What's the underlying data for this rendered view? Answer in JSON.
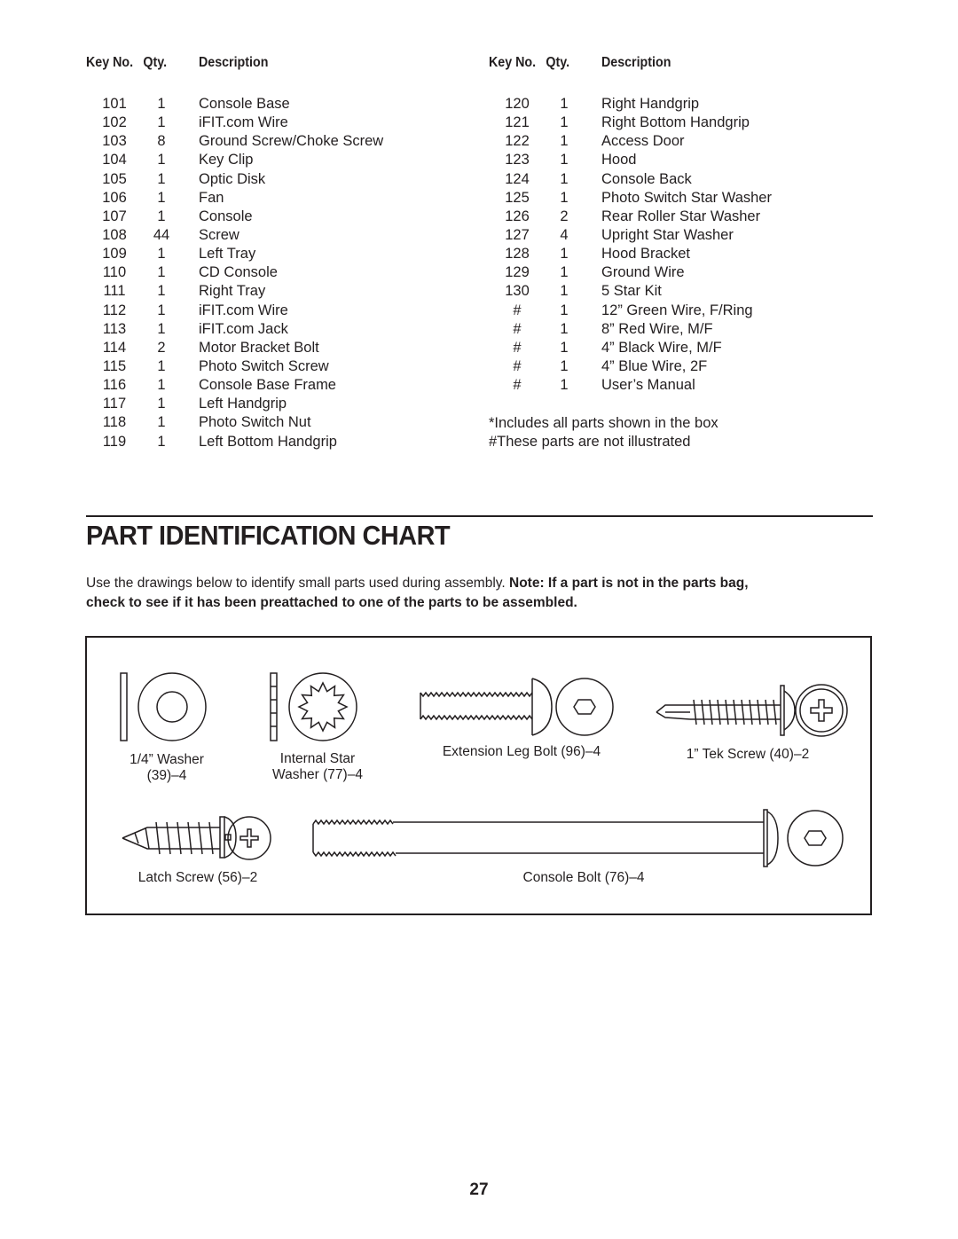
{
  "parts_list": {
    "headers": {
      "key": "Key No.",
      "qty": "Qty.",
      "desc": "Description"
    },
    "left_rows": [
      {
        "key": "101",
        "qty": "1",
        "desc": "Console Base"
      },
      {
        "key": "102",
        "qty": "1",
        "desc": "iFIT.com Wire"
      },
      {
        "key": "103",
        "qty": "8",
        "desc": "Ground Screw/Choke Screw"
      },
      {
        "key": "104",
        "qty": "1",
        "desc": "Key Clip"
      },
      {
        "key": "105",
        "qty": "1",
        "desc": "Optic Disk"
      },
      {
        "key": "106",
        "qty": "1",
        "desc": "Fan"
      },
      {
        "key": "107",
        "qty": "1",
        "desc": "Console"
      },
      {
        "key": "108",
        "qty": "44",
        "desc": "Screw"
      },
      {
        "key": "109",
        "qty": "1",
        "desc": "Left Tray"
      },
      {
        "key": "110",
        "qty": "1",
        "desc": "CD Console"
      },
      {
        "key": "111",
        "qty": "1",
        "desc": "Right Tray"
      },
      {
        "key": "112",
        "qty": "1",
        "desc": "iFIT.com Wire"
      },
      {
        "key": "113",
        "qty": "1",
        "desc": "iFIT.com Jack"
      },
      {
        "key": "114",
        "qty": "2",
        "desc": "Motor Bracket Bolt"
      },
      {
        "key": "115",
        "qty": "1",
        "desc": "Photo Switch Screw"
      },
      {
        "key": "116",
        "qty": "1",
        "desc": "Console Base Frame"
      },
      {
        "key": "117",
        "qty": "1",
        "desc": "Left Handgrip"
      },
      {
        "key": "118",
        "qty": "1",
        "desc": "Photo Switch Nut"
      },
      {
        "key": "119",
        "qty": "1",
        "desc": "Left Bottom Handgrip"
      }
    ],
    "right_rows": [
      {
        "key": "120",
        "qty": "1",
        "desc": "Right Handgrip"
      },
      {
        "key": "121",
        "qty": "1",
        "desc": "Right Bottom Handgrip"
      },
      {
        "key": "122",
        "qty": "1",
        "desc": "Access Door"
      },
      {
        "key": "123",
        "qty": "1",
        "desc": "Hood"
      },
      {
        "key": "124",
        "qty": "1",
        "desc": "Console Back"
      },
      {
        "key": "125",
        "qty": "1",
        "desc": "Photo Switch Star Washer"
      },
      {
        "key": "126",
        "qty": "2",
        "desc": "Rear Roller Star Washer"
      },
      {
        "key": "127",
        "qty": "4",
        "desc": "Upright Star Washer"
      },
      {
        "key": "128",
        "qty": "1",
        "desc": "Hood Bracket"
      },
      {
        "key": "129",
        "qty": "1",
        "desc": "Ground Wire"
      },
      {
        "key": "130",
        "qty": "1",
        "desc": "5 Star Kit"
      },
      {
        "key": "#",
        "qty": "1",
        "desc": "12” Green Wire, F/Ring"
      },
      {
        "key": "#",
        "qty": "1",
        "desc": "8” Red Wire, M/F"
      },
      {
        "key": "#",
        "qty": "1",
        "desc": "4” Black Wire, M/F"
      },
      {
        "key": "#",
        "qty": "1",
        "desc": "4” Blue Wire, 2F"
      },
      {
        "key": "#",
        "qty": "1",
        "desc": "User’s Manual"
      }
    ],
    "notes": [
      "*Includes all parts shown in the box",
      "#These parts are not illustrated"
    ]
  },
  "section": {
    "title": "PART IDENTIFICATION CHART",
    "intro_plain": "Use the drawings below to identify small parts used during assembly. ",
    "intro_bold_1": "Note: If a part is not in the parts bag,",
    "intro_bold_2": "check to see if it has been preattached to one of the parts to be assembled."
  },
  "drawings": {
    "washer": {
      "line1": "1/4” Washer",
      "line2": "(39)–4"
    },
    "star_washer": {
      "line1": "Internal Star",
      "line2": "Washer (77)–4"
    },
    "extension_leg_bolt": {
      "label": "Extension Leg Bolt (96)–4"
    },
    "tek_screw": {
      "label": "1” Tek Screw (40)–2"
    },
    "latch_screw": {
      "label": "Latch Screw (56)–2"
    },
    "console_bolt": {
      "label": "Console Bolt (76)–4"
    }
  },
  "page_number": "27"
}
